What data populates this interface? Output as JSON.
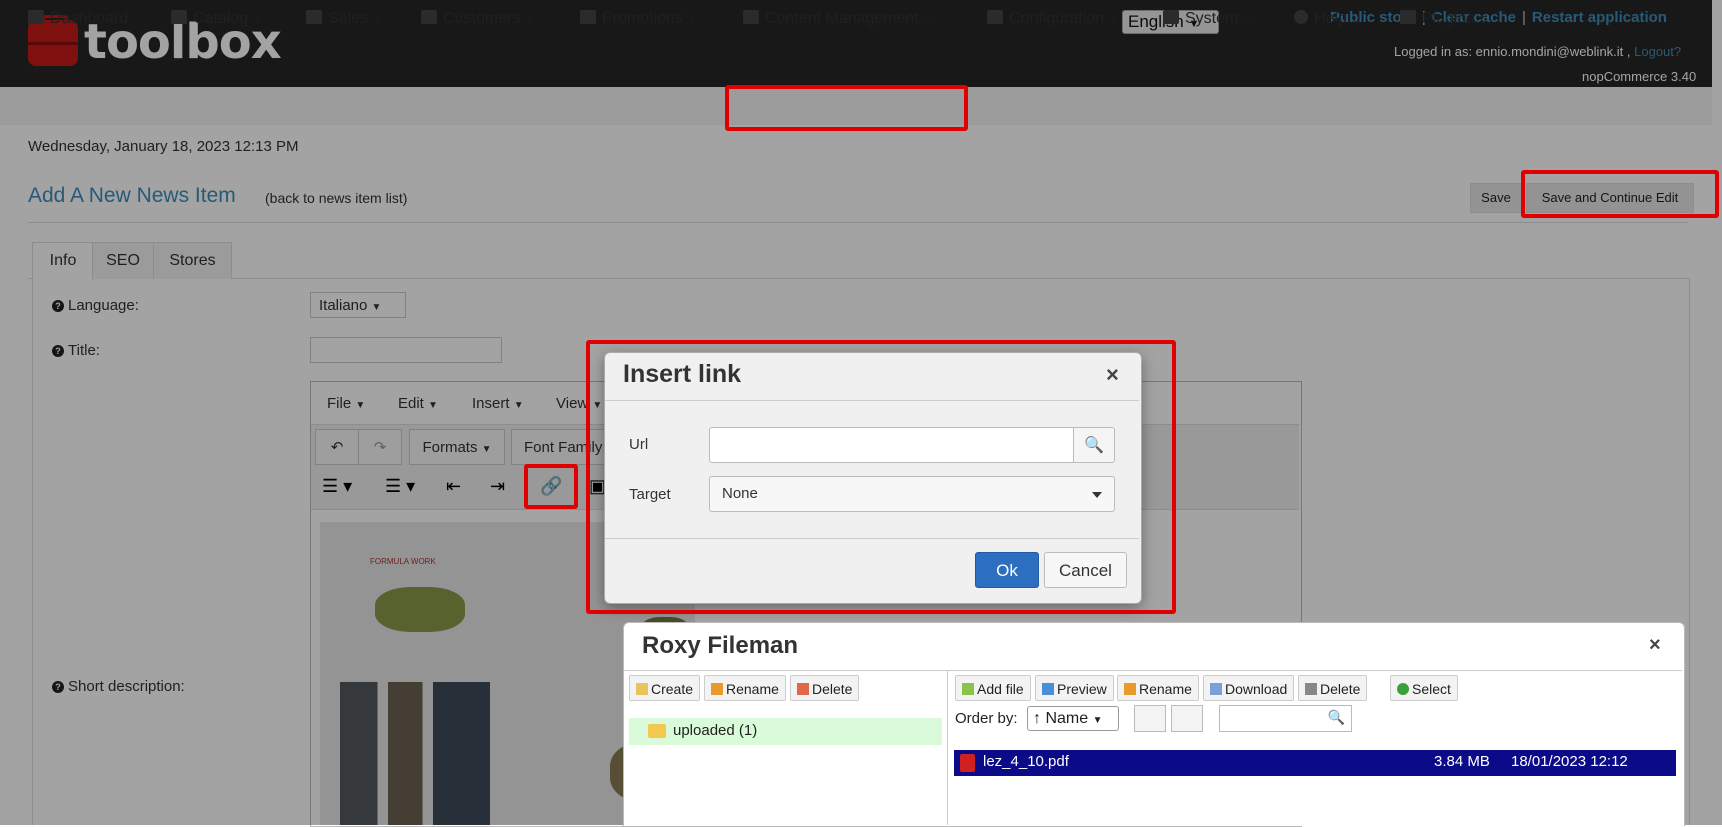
{
  "header": {
    "logo_text": "toolbox",
    "language": "English",
    "links": [
      "Public store",
      "Clear cache",
      "Restart application"
    ],
    "logged_in_prefix": "Logged in as: ennio.mondini@weblink.it ,",
    "logout": "Logout?",
    "version": "nopCommerce 3.40"
  },
  "nav": {
    "items": [
      "Dashboard",
      "Catalog",
      "Sales",
      "Customers",
      "Promotions",
      "Content Management",
      "Configuration",
      "System",
      "Help",
      "Plugins"
    ],
    "caret": "⌄"
  },
  "page": {
    "date": "Wednesday, January 18, 2023 12:13 PM",
    "title": "Add A New News Item",
    "back_link": "(back to news item list)",
    "save": "Save",
    "save_continue": "Save and Continue Edit",
    "tabs": [
      "Info",
      "SEO",
      "Stores"
    ],
    "fields": {
      "language_label": "Language:",
      "language_value": "Italiano",
      "title_label": "Title:",
      "short_desc_label": "Short description:"
    }
  },
  "editor": {
    "menus": [
      "File",
      "Edit",
      "Insert",
      "View"
    ],
    "formats": "Formats",
    "font_family": "Font Family"
  },
  "insert_link": {
    "title": "Insert link",
    "close": "×",
    "url_label": "Url",
    "url_value": "",
    "target_label": "Target",
    "target_value": "None",
    "ok": "Ok",
    "cancel": "Cancel"
  },
  "roxy": {
    "title": "Roxy Fileman",
    "close": "×",
    "folder_buttons": [
      "Create",
      "Rename",
      "Delete"
    ],
    "file_buttons": [
      "Add file",
      "Preview",
      "Rename",
      "Download",
      "Delete",
      "Select"
    ],
    "folder": "uploaded (1)",
    "order_by_label": "Order by:",
    "order_by_value": "↑ Name",
    "files": [
      {
        "name": "lez_4_10.pdf",
        "size": "3.84 MB",
        "date": "18/01/2023 12:12"
      }
    ]
  },
  "colors": {
    "header_bg": "#262626",
    "link": "#3c8dbc",
    "highlight": "#e00000",
    "ok_button": "#2c6ec0",
    "selected_row": "#0b0b8a"
  }
}
